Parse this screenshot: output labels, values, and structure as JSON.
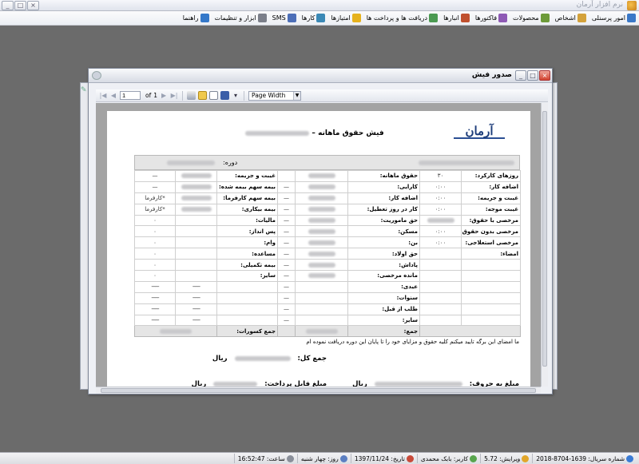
{
  "app": {
    "title": "نرم افزار آرمان",
    "window_controls": [
      "_",
      "□",
      "×"
    ]
  },
  "menu": [
    {
      "label": "امور پرسنلی",
      "icon": "people-icon",
      "color": "#3a78c8"
    },
    {
      "label": "اشخاص",
      "icon": "person-icon",
      "color": "#d4a23b"
    },
    {
      "label": "محصولات",
      "icon": "box-icon",
      "color": "#6d9b3a"
    },
    {
      "label": "فاکتورها",
      "icon": "invoice-icon",
      "color": "#8e5ab5"
    },
    {
      "label": "انبارها",
      "icon": "warehouse-icon",
      "color": "#c0502e"
    },
    {
      "label": "دریافت ها و پرداخت ها",
      "icon": "money-icon",
      "color": "#4b9a52"
    },
    {
      "label": "امتیازها",
      "icon": "star-icon",
      "color": "#e6b21d"
    },
    {
      "label": "کارها",
      "icon": "tasks-icon",
      "color": "#3b89b6"
    },
    {
      "label": "SMS",
      "icon": "sms-icon",
      "color": "#4d6fb8"
    },
    {
      "label": "ابزار و تنظیمات",
      "icon": "tools-icon",
      "color": "#7b7f8a"
    },
    {
      "label": "راهنما",
      "icon": "help-icon",
      "color": "#3478c9"
    }
  ],
  "dialog": {
    "title": "صدور فیش",
    "controls": [
      "_",
      "□",
      "×"
    ],
    "toolbar": {
      "page": "1",
      "of_label": "of",
      "total": "1",
      "zoom": "Page Width",
      "nav": [
        "|◀",
        "◀",
        "▶",
        "▶|"
      ]
    }
  },
  "report": {
    "logo": "آرمان",
    "title": "فیش حقوق ماهانه",
    "period_label": "دوره:",
    "rows": [
      [
        "روزهای کارکرد:",
        "۳۰",
        "حقوق ماهانه:",
        "",
        "",
        "غیبت و جریمه:",
        "",
        "—"
      ],
      [
        "اضافه کار:",
        "۰:۰۰",
        "کارایی:",
        "",
        "—",
        "بیمه سهم بیمه شده:",
        "",
        "—"
      ],
      [
        "غیبت و جریمه:",
        "۰:۰۰",
        "اضافه کار:",
        "",
        "—",
        "بیمه سهم کارفرما:",
        "",
        "*کارفرما"
      ],
      [
        "غیبت موجه:",
        "۰:۰۰",
        "کار در روز تعطیل:",
        "",
        "—",
        "بیمه بیکاری:",
        "",
        "*کارفرما"
      ],
      [
        "مرخصی با حقوق:",
        "",
        "حق ماموریت:",
        "",
        "—",
        "مالیات:",
        "",
        "۰"
      ],
      [
        "مرخصی بدون حقوق بدون بیمه:",
        "۰:۰۰",
        "مسکن:",
        "",
        "—",
        "پس انداز:",
        "",
        "۰"
      ],
      [
        "مرخصی استعلاجی:",
        "۰:۰۰",
        "بن:",
        "",
        "—",
        "وام:",
        "",
        "۰"
      ],
      [
        "امضاء:",
        "",
        "حق اولاد:",
        "",
        "—",
        "مساعده:",
        "",
        "۰"
      ],
      [
        "",
        "",
        "پاداش:",
        "",
        "—",
        "بیمه تکمیلی:",
        "",
        "۰"
      ],
      [
        "",
        "",
        "مانده مرخصی:",
        "",
        "—",
        "سایر:",
        "",
        "۰"
      ],
      [
        "",
        "",
        "عیدی:",
        "",
        "—",
        "",
        "------",
        "------"
      ],
      [
        "",
        "",
        "سنوات:",
        "",
        "—",
        "",
        "------",
        "------"
      ],
      [
        "",
        "",
        "طلب از قبل:",
        "",
        "—",
        "",
        "------",
        "------"
      ],
      [
        "",
        "",
        "سایر:",
        "",
        "—",
        "",
        "------",
        "------"
      ]
    ],
    "total_income_label": "جمع:",
    "total_deductions_label": "جمع کسورات:",
    "note": "ما امضای این برگه تایید میکنم کلیه حقوق و مزایای خود را تا پایان این دوره دریافت نموده ام",
    "sum_label": "جمع کل:",
    "currency": "ریال",
    "final_label": "مبلغ فایل پرداخت:",
    "words_label": "مبلغ به حروف:"
  },
  "status": [
    {
      "icon": "serial-icon",
      "text": "شماره سریال: 1639-8704-2018"
    },
    {
      "icon": "version-icon",
      "text": "ویرایش: 5.72"
    },
    {
      "icon": "user-icon",
      "text": "کاربر: بابک محمدی"
    },
    {
      "icon": "calendar-icon",
      "text": "تاریخ: 1397/11/24"
    },
    {
      "icon": "day-icon",
      "text": "روز: چهار شنبه"
    },
    {
      "icon": "clock-icon",
      "text": "ساعت: 16:52:47"
    }
  ]
}
